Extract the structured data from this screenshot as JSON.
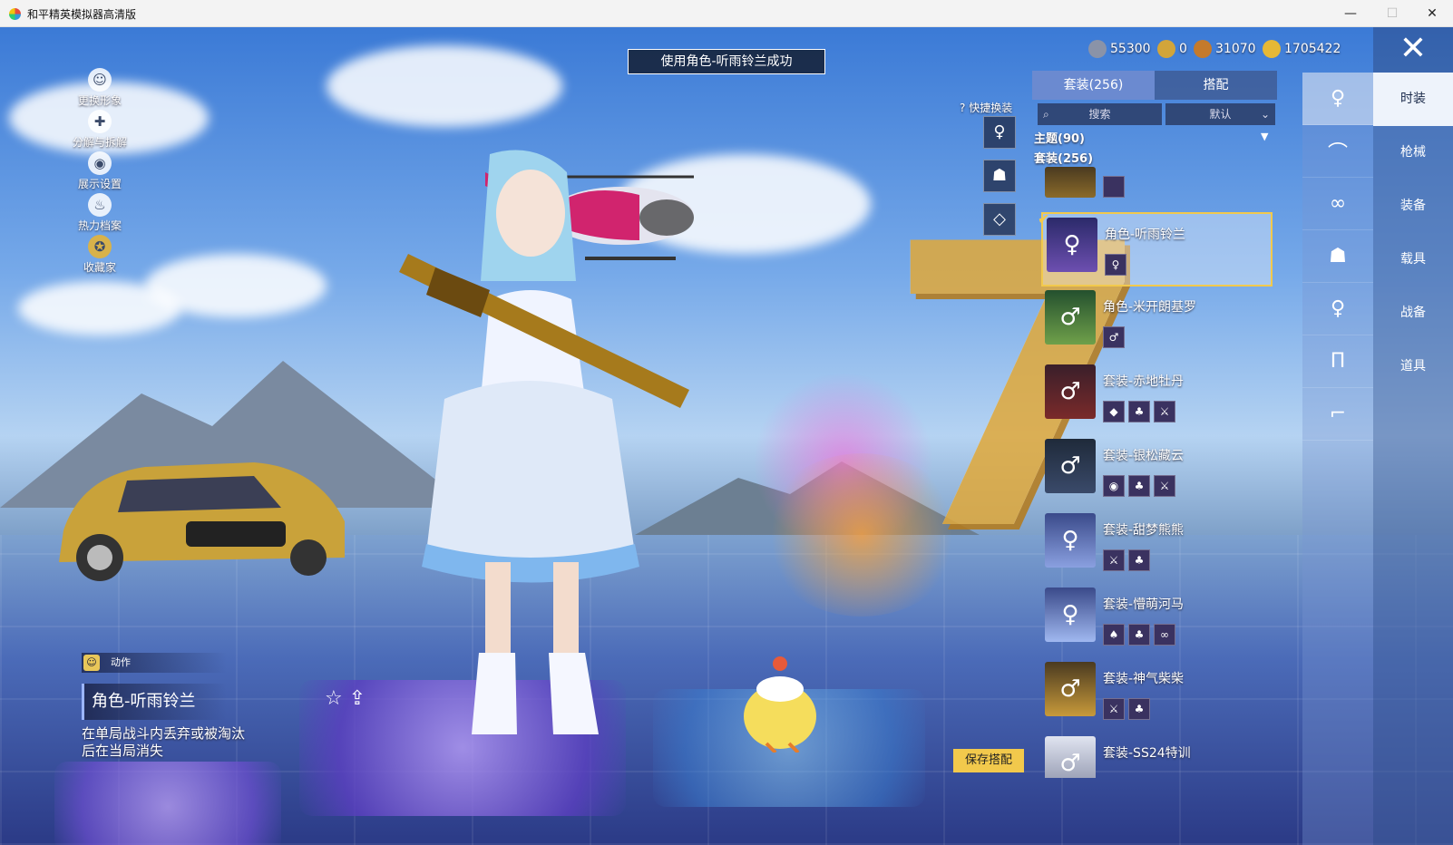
{
  "window": {
    "title": "和平精英模拟器高清版",
    "min": "—",
    "max": "☐",
    "close": "✕"
  },
  "toast": "使用角色-听雨铃兰成功",
  "currencies": [
    {
      "icon": "silver-coin-icon",
      "value": "55300",
      "color": "#8a93a8"
    },
    {
      "icon": "gold-a-coin-icon",
      "value": "0",
      "color": "#d2a53a"
    },
    {
      "icon": "bronze-coin-icon",
      "value": "31070",
      "color": "#c47a2c"
    },
    {
      "icon": "gold-coin-icon",
      "value": "1705422",
      "color": "#e6b836"
    }
  ],
  "close_icon": "✕",
  "left_menu": [
    {
      "icon": "portrait-icon",
      "glyph": "☺",
      "label": "更换形象"
    },
    {
      "icon": "puzzle-icon",
      "glyph": "✚",
      "label": "分解与拆解"
    },
    {
      "icon": "eye-icon",
      "glyph": "◉",
      "label": "展示设置"
    },
    {
      "icon": "flame-icon",
      "glyph": "♨",
      "label": "热力档案"
    },
    {
      "icon": "collector-badge-icon",
      "glyph": "✪",
      "label": "收藏家"
    }
  ],
  "categories": [
    {
      "label": "时装",
      "active": true
    },
    {
      "label": "枪械",
      "active": false
    },
    {
      "label": "装备",
      "active": false
    },
    {
      "label": "载具",
      "active": false
    },
    {
      "label": "战备",
      "active": false
    },
    {
      "label": "道具",
      "active": false
    }
  ],
  "subcategories": [
    {
      "icon": "full-body-icon",
      "glyph": "♀",
      "active": true
    },
    {
      "icon": "cap-icon",
      "glyph": "⌒",
      "active": false
    },
    {
      "icon": "glasses-icon",
      "glyph": "∞",
      "active": false
    },
    {
      "icon": "mask-icon",
      "glyph": "☗",
      "active": false
    },
    {
      "icon": "top-icon",
      "glyph": "♀",
      "active": false
    },
    {
      "icon": "pants-icon",
      "glyph": "Π",
      "active": false
    },
    {
      "icon": "shoes-icon",
      "glyph": "⌐",
      "active": false
    }
  ],
  "tabs": [
    {
      "label": "套装(256)",
      "active": true
    },
    {
      "label": "搭配",
      "active": false
    }
  ],
  "search": {
    "label": "搜索",
    "sort": "默认"
  },
  "groups": {
    "theme": "主题(90)",
    "suits": "套装(256)"
  },
  "outfits": [
    {
      "name": "角色-听雨铃兰",
      "selected": true,
      "parts": [
        "♀"
      ]
    },
    {
      "name": "角色-米开朗基罗",
      "selected": false,
      "parts": [
        "♂"
      ]
    },
    {
      "name": "套装-赤地牡丹",
      "selected": false,
      "parts": [
        "◆",
        "♣",
        "⚔"
      ]
    },
    {
      "name": "套装-银松藏云",
      "selected": false,
      "parts": [
        "◉",
        "♣",
        "⚔"
      ]
    },
    {
      "name": "套装-甜梦熊熊",
      "selected": false,
      "parts": [
        "⚔",
        "♣"
      ]
    },
    {
      "name": "套装-懵萌河马",
      "selected": false,
      "parts": [
        "♠",
        "♣",
        "∞"
      ]
    },
    {
      "name": "套装-神气柴柴",
      "selected": false,
      "parts": [
        "⚔",
        "♣"
      ]
    },
    {
      "name": "套装-SS24特训",
      "selected": false,
      "parts": []
    }
  ],
  "quick_swap": {
    "label": "快捷换装",
    "help": "?",
    "slots": [
      "♀",
      "☗",
      "◇"
    ]
  },
  "animation_tag": "动作",
  "item_title": "角色-听雨铃兰",
  "item_desc": "在单局战斗内丢弃或被淘汰后在当局消失",
  "save_button": "保存搭配"
}
